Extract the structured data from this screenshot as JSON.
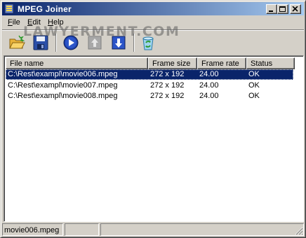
{
  "window": {
    "title": "MPEG Joiner",
    "controls": [
      "minimize",
      "maximize",
      "close"
    ]
  },
  "menu": [
    {
      "label": "File",
      "mnemonic": "F",
      "rest": "ile"
    },
    {
      "label": "Edit",
      "mnemonic": "E",
      "rest": "dit"
    },
    {
      "label": "Help",
      "mnemonic": "H",
      "rest": "elp"
    }
  ],
  "watermark": "LAWYERMENT.COM",
  "toolbar": {
    "buttons": [
      {
        "icon": "open-folder-icon",
        "action": "add-files"
      },
      {
        "icon": "save-disk-icon",
        "action": "join-save"
      },
      {
        "icon": "play-icon",
        "action": "start"
      },
      {
        "icon": "arrow-up-icon",
        "action": "move-up"
      },
      {
        "icon": "arrow-down-icon",
        "action": "move-down"
      },
      {
        "icon": "recycle-bin-icon",
        "action": "remove"
      }
    ]
  },
  "list": {
    "columns": [
      "File name",
      "Frame size",
      "Frame rate",
      "Status"
    ],
    "rows": [
      {
        "file": "C:\\Rest\\exampl\\movie006.mpeg",
        "size": "272 x 192",
        "rate": "24.00",
        "status": "OK",
        "selected": true
      },
      {
        "file": "C:\\Rest\\exampl\\movie007.mpeg",
        "size": "272 x 192",
        "rate": "24.00",
        "status": "OK",
        "selected": false
      },
      {
        "file": "C:\\Rest\\exampl\\movie008.mpeg",
        "size": "272 x 192",
        "rate": "24.00",
        "status": "OK",
        "selected": false
      }
    ]
  },
  "status": {
    "panels": [
      "movie006.mpeg",
      "",
      ""
    ]
  },
  "colors": {
    "title_gradient_start": "#0a246a",
    "title_gradient_end": "#a6caf0",
    "selection": "#0a246a",
    "face": "#d4d0c8"
  }
}
